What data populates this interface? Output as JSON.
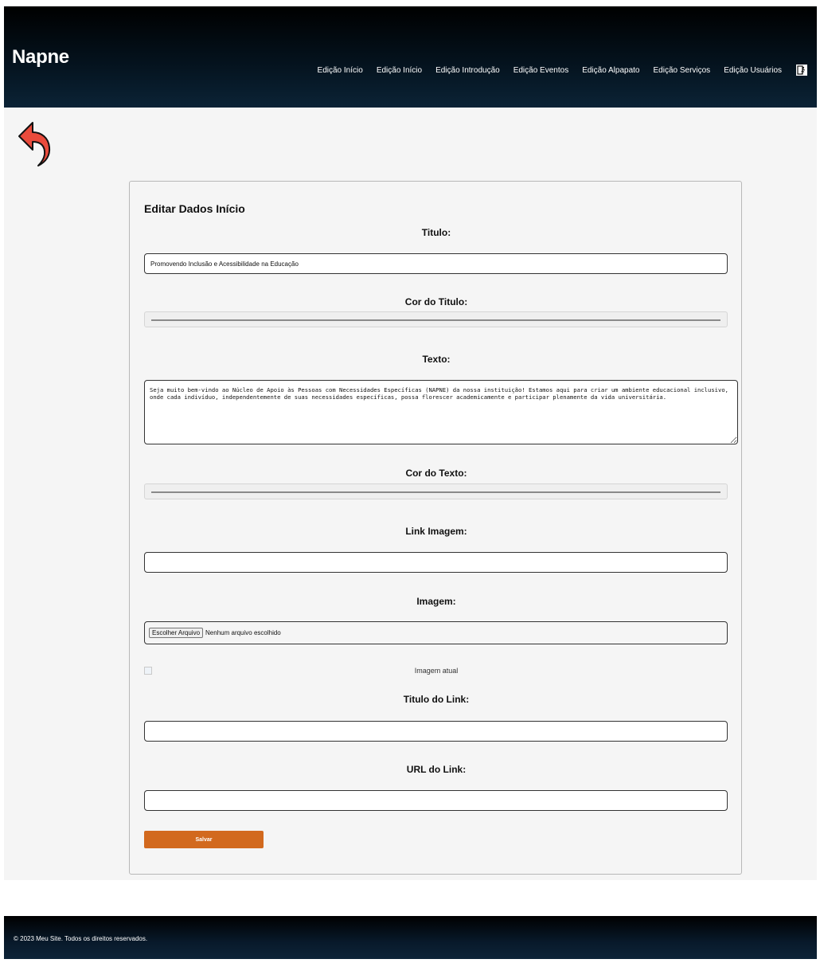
{
  "header": {
    "brand": "Napne",
    "nav": [
      "Edição Início",
      "Edição Início",
      "Edição Introdução",
      "Edição Eventos",
      "Edição Alpapato",
      "Edição Serviços",
      "Edição Usuários"
    ],
    "logout_icon": "logout-door-icon"
  },
  "back_icon": "back-arrow-icon",
  "form": {
    "title": "Editar Dados Início",
    "titulo_label": "Titulo:",
    "titulo_value": "Promovendo Inclusão e Acessibilidade na Educação",
    "cor_titulo_label": "Cor do Titulo:",
    "texto_label": "Texto:",
    "texto_value": "Seja muito bem-vindo ao Núcleo de Apoio às Pessoas com Necessidades Específicas (NAPNE) da nossa instituição! Estamos aqui para criar um ambiente educacional inclusivo, onde cada indivíduo, independentemente de suas necessidades específicas, possa florescer academicamente e participar plenamente da vida universitária.",
    "cor_texto_label": "Cor do Texto:",
    "link_imagem_label": "Link Imagem:",
    "link_imagem_value": "",
    "imagem_label": "Imagem:",
    "file_button": "Escolher Arquivo",
    "file_status": "Nenhum arquivo escolhido",
    "current_image_label": "Imagem atual",
    "titulo_link_label": "Titulo do Link:",
    "titulo_link_value": "",
    "url_link_label": "URL do Link:",
    "url_link_value": "",
    "save_label": "Salvar"
  },
  "colors": {
    "header_bg": "#04121d",
    "accent": "#d2691e",
    "back_arrow": "#e94b3c"
  },
  "footer": {
    "text": "© 2023 Meu Site. Todos os direitos reservados."
  }
}
